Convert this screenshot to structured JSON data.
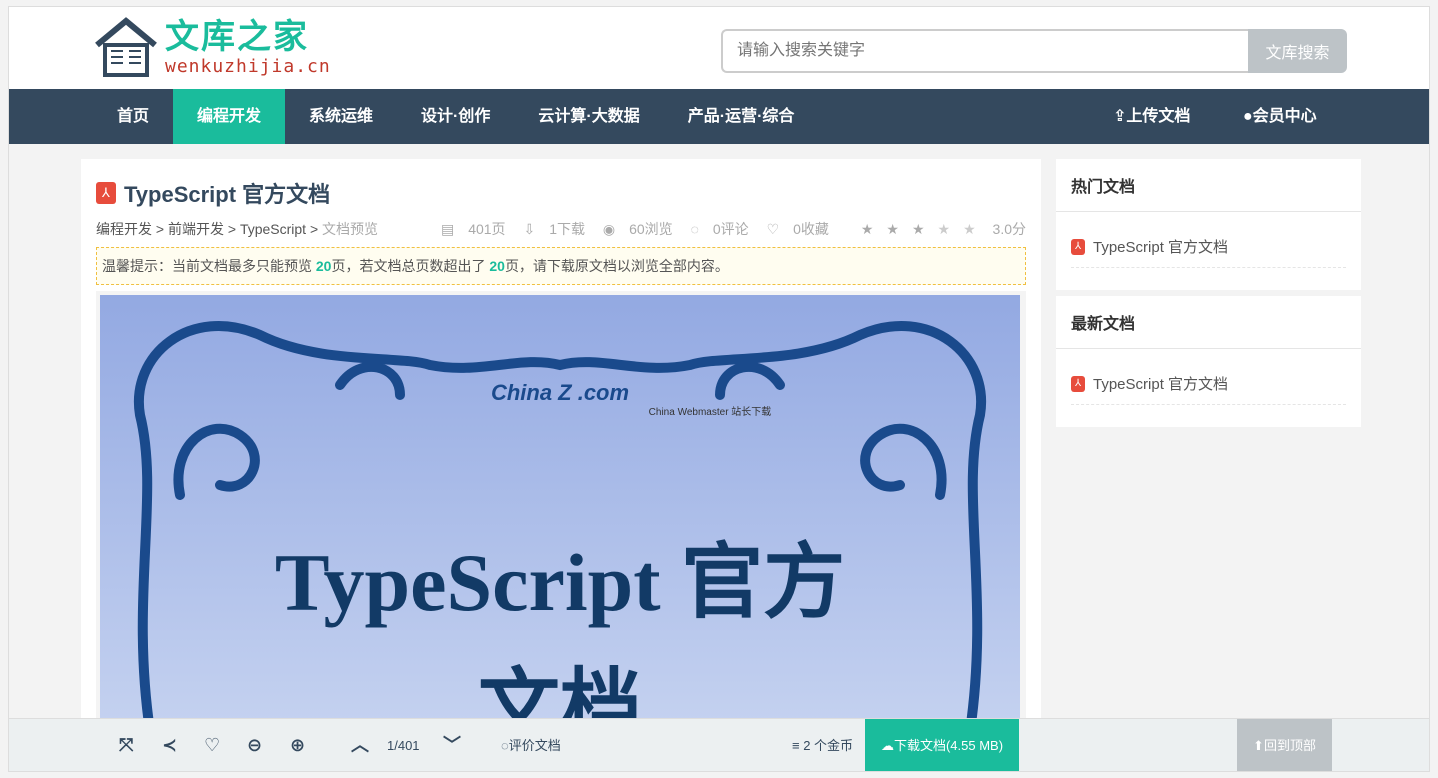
{
  "logo": {
    "cn": "文库之家",
    "en": "wenkuzhijia.cn"
  },
  "search": {
    "placeholder": "请输入搜索关键字",
    "button": "文库搜索"
  },
  "nav": {
    "items": [
      "首页",
      "编程开发",
      "系统运维",
      "设计·创作",
      "云计算·大数据",
      "产品·运营·综合"
    ],
    "upload": "上传文档",
    "member": "会员中心"
  },
  "doc": {
    "title": "TypeScript 官方文档",
    "breadcrumb": [
      "编程开发",
      "前端开发",
      "TypeScript",
      "文档预览"
    ],
    "pages": "401页",
    "downloads": "1下载",
    "views": "60浏览",
    "comments": "0评论",
    "favorites": "0收藏",
    "rating_value": 3,
    "rating_max": 5,
    "rating": "3.0分",
    "tip_pre": "温馨提示：当前文档最多只能预览 ",
    "tip_n1": "20",
    "tip_mid": "页，若文档总页数超出了 ",
    "tip_n2": "20",
    "tip_post": "页，请下载原文档以浏览全部内容。",
    "cover_title1": "TypeScript 官方",
    "cover_title2": "文档",
    "watermark": "China Z .com",
    "watermark_sub": "China Webmaster 站长下载"
  },
  "sidebar": {
    "hot_title": "热门文档",
    "hot": [
      "TypeScript 官方文档"
    ],
    "new_title": "最新文档",
    "new": [
      "TypeScript 官方文档"
    ]
  },
  "toolbar": {
    "page": "1/401",
    "comment": "评价文档",
    "coins": "2 个金币",
    "download": "下载文档(4.55 MB)",
    "top": "回到顶部"
  },
  "colors": {
    "accent": "#1abc9c",
    "nav": "#34495e"
  }
}
